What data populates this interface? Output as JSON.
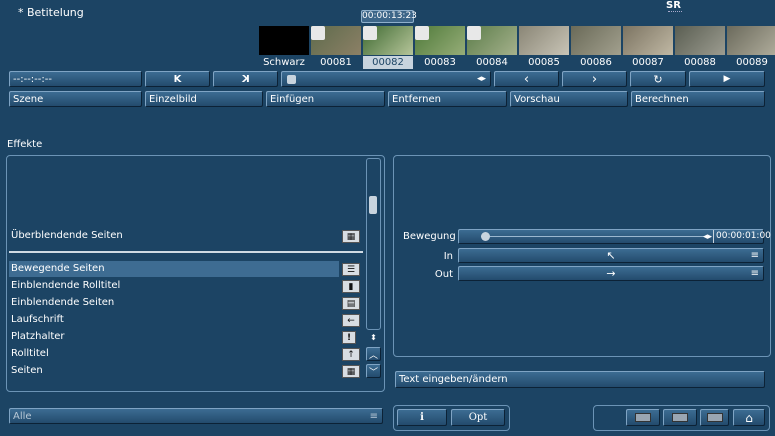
{
  "title": "* Betitelung",
  "sr_label": "SR",
  "timecode": "00:00:13:23",
  "timecode_field": "--:--:--:--",
  "thumbnails": [
    {
      "label": "Schwarz",
      "selected": false
    },
    {
      "label": "00081",
      "selected": false
    },
    {
      "label": "00082",
      "selected": true
    },
    {
      "label": "00083",
      "selected": false
    },
    {
      "label": "00084",
      "selected": false
    },
    {
      "label": "00085",
      "selected": false
    },
    {
      "label": "00086",
      "selected": false
    },
    {
      "label": "00087",
      "selected": false
    },
    {
      "label": "00088",
      "selected": false
    },
    {
      "label": "00089",
      "selected": false
    }
  ],
  "transport": {
    "first": "K",
    "last": "K",
    "prev": "‹",
    "next": "›",
    "loop": "↻",
    "play": "▶",
    "scrub_arrows": "◂▸"
  },
  "menu": {
    "szene": "Szene",
    "einzelbild": "Einzelbild",
    "einfuegen": "Einfügen",
    "entfernen": "Entfernen",
    "vorschau": "Vorschau",
    "berechnen": "Berechnen"
  },
  "effects": {
    "heading": "Effekte",
    "category": "Überblendende Seiten",
    "items": [
      {
        "label": "Bewegende Seiten",
        "icon": "grid-list-icon",
        "selected": true
      },
      {
        "label": "Einblendende Rolltitel",
        "icon": "roll-icon",
        "selected": false
      },
      {
        "label": "Einblendende Seiten",
        "icon": "page-icon",
        "selected": false
      },
      {
        "label": "Laufschrift",
        "icon": "arrow-left-icon",
        "selected": false
      },
      {
        "label": "Platzhalter",
        "icon": "exclamation-icon",
        "selected": false
      },
      {
        "label": "Rolltitel",
        "icon": "arrow-up-icon",
        "selected": false
      },
      {
        "label": "Seiten",
        "icon": "grid-icon",
        "selected": false
      }
    ],
    "filter": "Alle"
  },
  "properties": {
    "bewegung_label": "Bewegung",
    "bewegung_time": "00:00:01:00",
    "in_label": "In",
    "out_label": "Out",
    "text_button": "Text eingeben/ändern"
  },
  "bottom": {
    "info": "i",
    "opt": "Opt"
  }
}
